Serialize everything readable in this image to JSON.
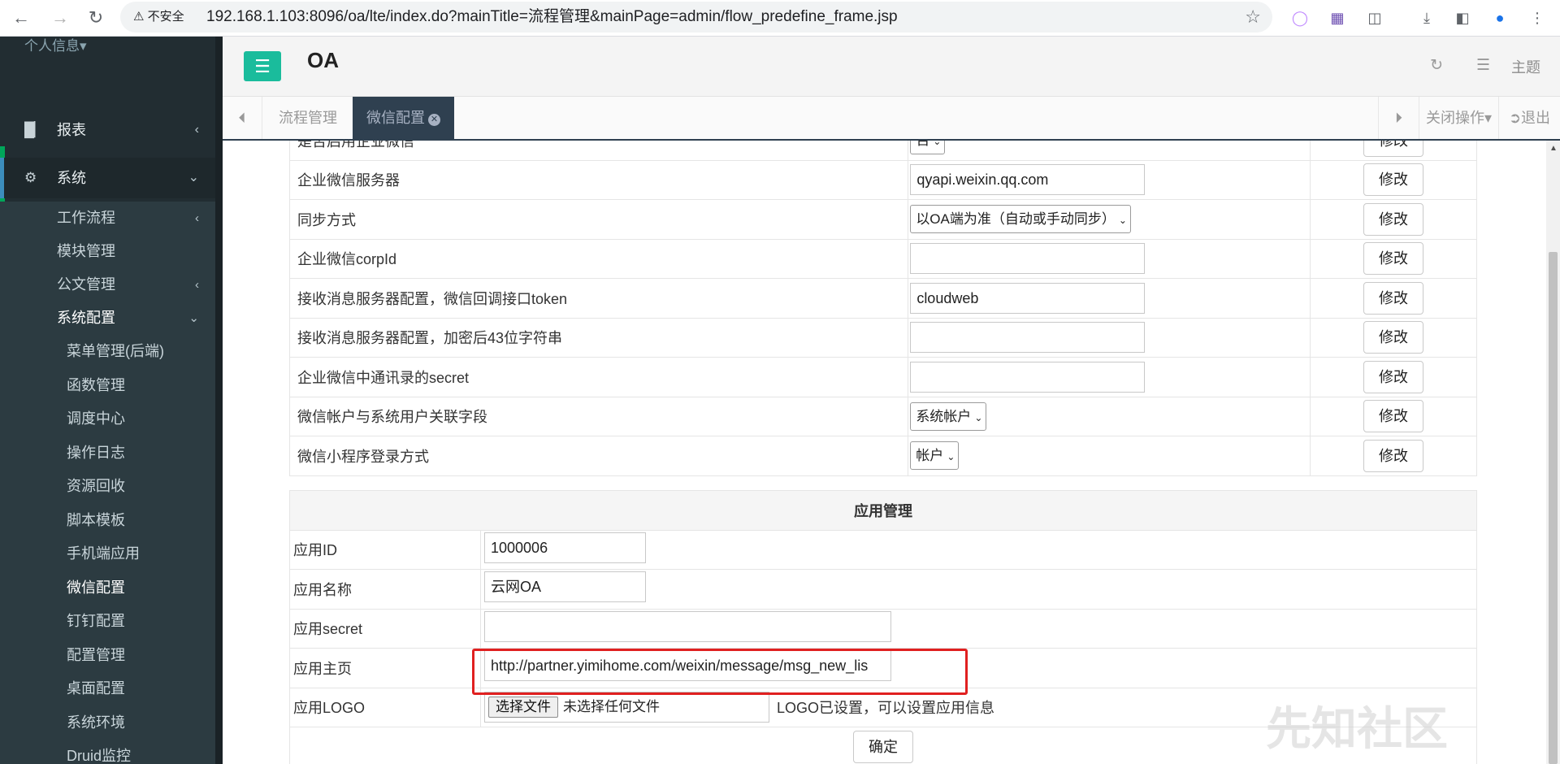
{
  "browser": {
    "security_label": "不安全",
    "url": "192.168.1.103:8096/oa/lte/index.do?mainTitle=流程管理&mainPage=admin/flow_predefine_frame.jsp"
  },
  "sidebar": {
    "user": "个人信息",
    "reports": "报表",
    "system": "系统",
    "sub": [
      "工作流程",
      "模块管理",
      "公文管理",
      "系统配置"
    ],
    "config_items": [
      "菜单管理(后端)",
      "函数管理",
      "调度中心",
      "操作日志",
      "资源回收",
      "脚本模板",
      "手机端应用",
      "微信配置",
      "钉钉配置",
      "配置管理",
      "桌面配置",
      "系统环境",
      "Druid监控"
    ]
  },
  "header": {
    "title": "OA",
    "theme": "主题"
  },
  "tabs": {
    "items": [
      "流程管理",
      "微信配置"
    ],
    "close_ops": "关闭操作",
    "logout": "退出"
  },
  "config_rows": [
    {
      "label": "是否启用企业微信",
      "kind": "select",
      "value": "否",
      "action": "修改"
    },
    {
      "label": "企业微信服务器",
      "kind": "input",
      "value": "qyapi.weixin.qq.com",
      "action": "修改"
    },
    {
      "label": "同步方式",
      "kind": "select",
      "value": "以OA端为准（自动或手动同步）",
      "action": "修改"
    },
    {
      "label": "企业微信corpId",
      "kind": "input",
      "value": "",
      "action": "修改"
    },
    {
      "label": "接收消息服务器配置，微信回调接口token",
      "kind": "input",
      "value": "cloudweb",
      "action": "修改"
    },
    {
      "label": "接收消息服务器配置，加密后43位字符串",
      "kind": "input",
      "value": "",
      "action": "修改"
    },
    {
      "label": "企业微信中通讯录的secret",
      "kind": "input",
      "value": "",
      "action": "修改"
    },
    {
      "label": "微信帐户与系统用户关联字段",
      "kind": "select",
      "value": "系统帐户",
      "action": "修改"
    },
    {
      "label": "微信小程序登录方式",
      "kind": "select",
      "value": "帐户",
      "action": "修改"
    }
  ],
  "app_mgmt": {
    "section_title": "应用管理",
    "app_id_label": "应用ID",
    "app_id": "1000006",
    "app_name_label": "应用名称",
    "app_name": "云网OA",
    "app_secret_label": "应用secret",
    "app_secret": "",
    "home_label": "应用主页",
    "home_url": "http://partner.yimihome.com/weixin/message/msg_new_lis",
    "logo_label": "应用LOGO",
    "file_button": "选择文件",
    "file_status": "未选择任何文件",
    "logo_note": "LOGO已设置，可以设置应用信息",
    "confirm": "确定"
  },
  "watermark": "先知社区"
}
